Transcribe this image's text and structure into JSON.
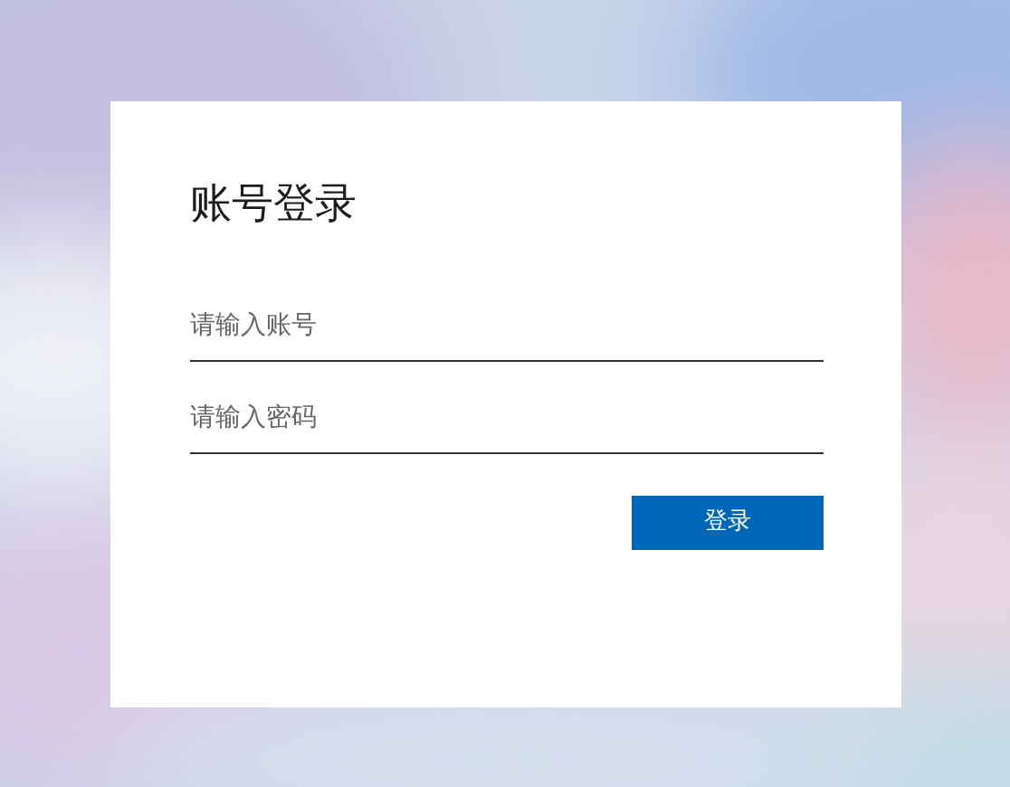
{
  "title": "账号登录",
  "fields": [
    {
      "placeholder": "请输入账号"
    },
    {
      "placeholder": "请输入密码"
    }
  ],
  "submit": {
    "label": "登录"
  }
}
